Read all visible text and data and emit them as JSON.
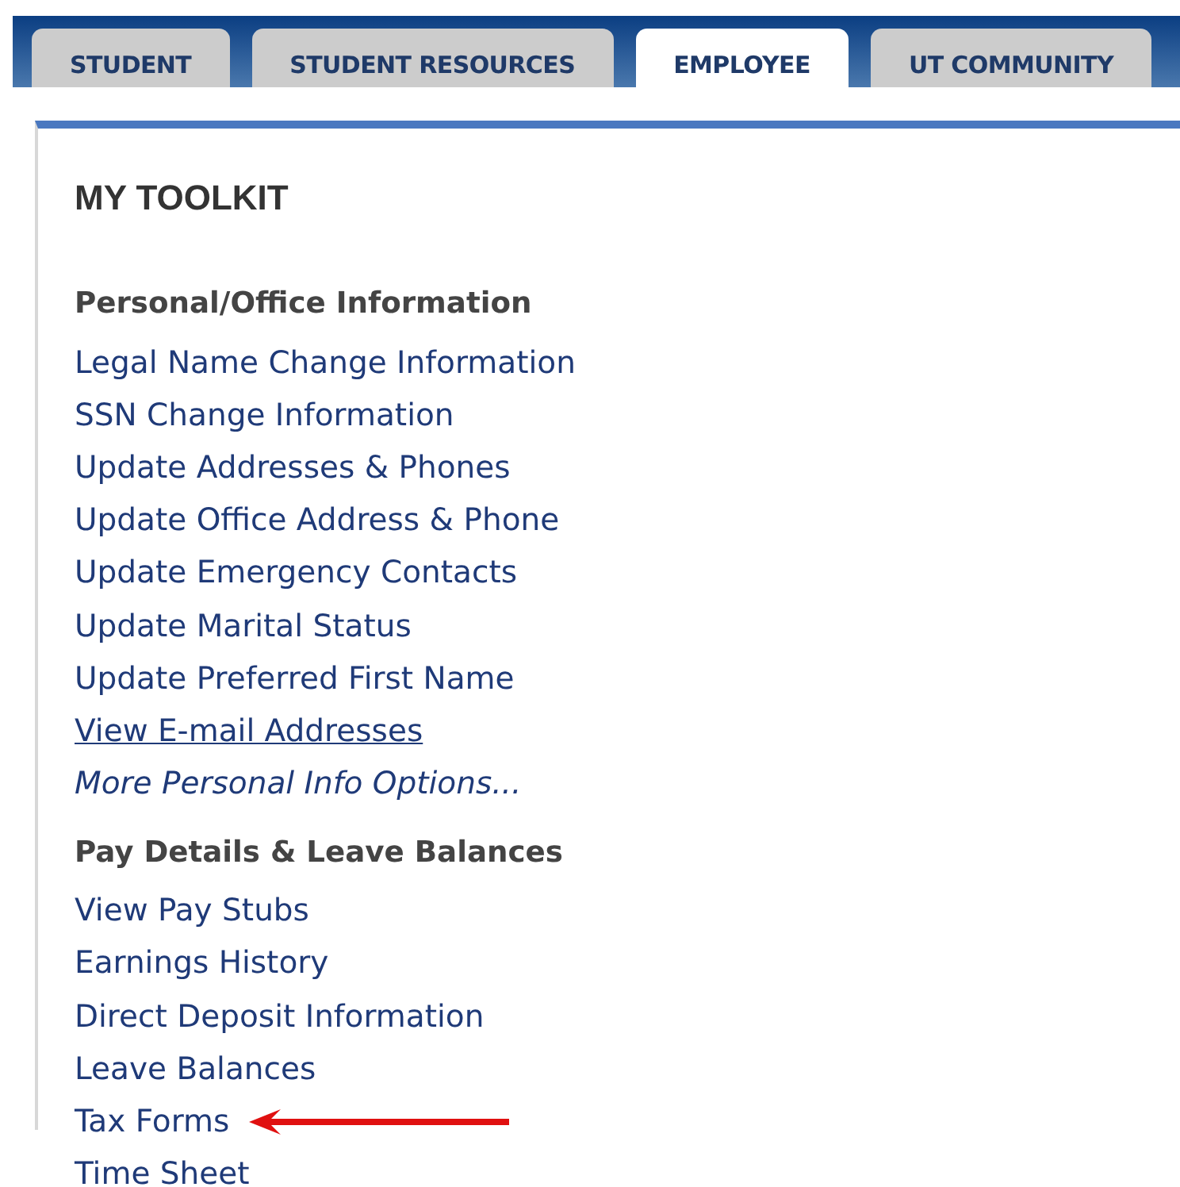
{
  "tabs": [
    {
      "label": "STUDENT",
      "selected": false
    },
    {
      "label": "STUDENT RESOURCES",
      "selected": false
    },
    {
      "label": "EMPLOYEE",
      "selected": true
    },
    {
      "label": "UT COMMUNITY",
      "selected": false
    }
  ],
  "toolkit": {
    "title": "MY TOOLKIT",
    "groups": [
      {
        "heading": "Personal/Office Information",
        "items": [
          {
            "label": "Legal Name Change Information",
            "kind": "link",
            "arrow": false
          },
          {
            "label": "SSN Change Information",
            "kind": "link",
            "arrow": false
          },
          {
            "label": "Update Addresses & Phones",
            "kind": "link",
            "arrow": false
          },
          {
            "label": "Update Office Address & Phone",
            "kind": "link",
            "arrow": false
          },
          {
            "label": "Update Emergency Contacts",
            "kind": "link",
            "arrow": false
          },
          {
            "label": "Update Marital Status",
            "kind": "link",
            "arrow": false
          },
          {
            "label": "Update Preferred First Name",
            "kind": "link",
            "arrow": false
          },
          {
            "label": "View E-mail Addresses",
            "kind": "underlined",
            "arrow": false
          },
          {
            "label": "More Personal Info Options...",
            "kind": "more",
            "arrow": false
          }
        ]
      },
      {
        "heading": "Pay Details & Leave Balances",
        "items": [
          {
            "label": "View Pay Stubs",
            "kind": "link",
            "arrow": false
          },
          {
            "label": "Earnings History",
            "kind": "link",
            "arrow": false
          },
          {
            "label": "Direct Deposit Information",
            "kind": "link",
            "arrow": false
          },
          {
            "label": "Leave Balances",
            "kind": "link",
            "arrow": false
          },
          {
            "label": "Tax Forms",
            "kind": "link",
            "arrow": true
          },
          {
            "label": "Time Sheet",
            "kind": "link",
            "arrow": false
          }
        ]
      }
    ]
  }
}
